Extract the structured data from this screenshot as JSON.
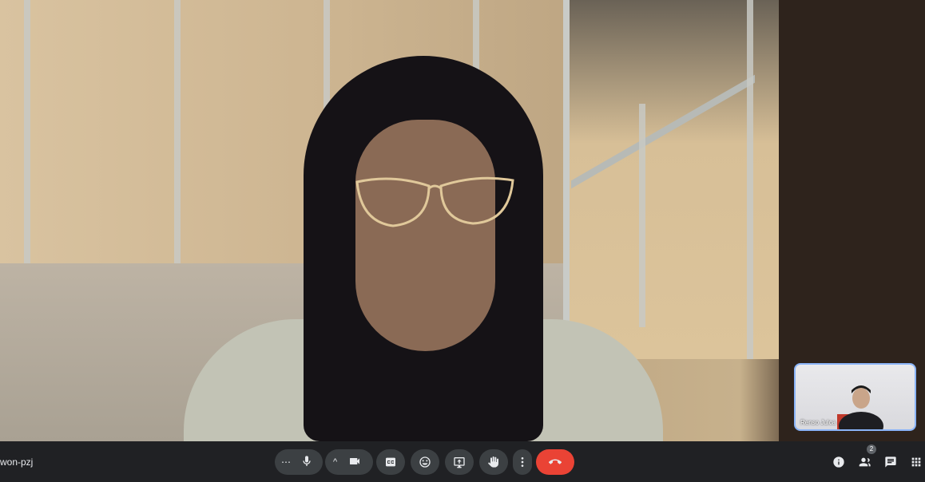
{
  "meeting": {
    "code": "won-pzj"
  },
  "self_view": {
    "participant_name": "Renso Julca"
  },
  "toolbar": {
    "more_pill_label": "⋯",
    "present_chevron_label": "^",
    "participants_count": "2"
  },
  "icons": {
    "mic": "microphone-icon",
    "camera": "camera-icon",
    "captions": "captions-icon",
    "emoji": "emoji-icon",
    "present": "present-icon",
    "hand": "raise-hand-icon",
    "more": "more-vertical-icon",
    "end": "end-call-icon",
    "info": "info-icon",
    "people": "people-icon",
    "chat": "chat-icon",
    "apps": "apps-icon"
  },
  "colors": {
    "end_call": "#ea4335",
    "self_view_border": "#8ab4f8",
    "toolbar_bg": "#202124"
  }
}
